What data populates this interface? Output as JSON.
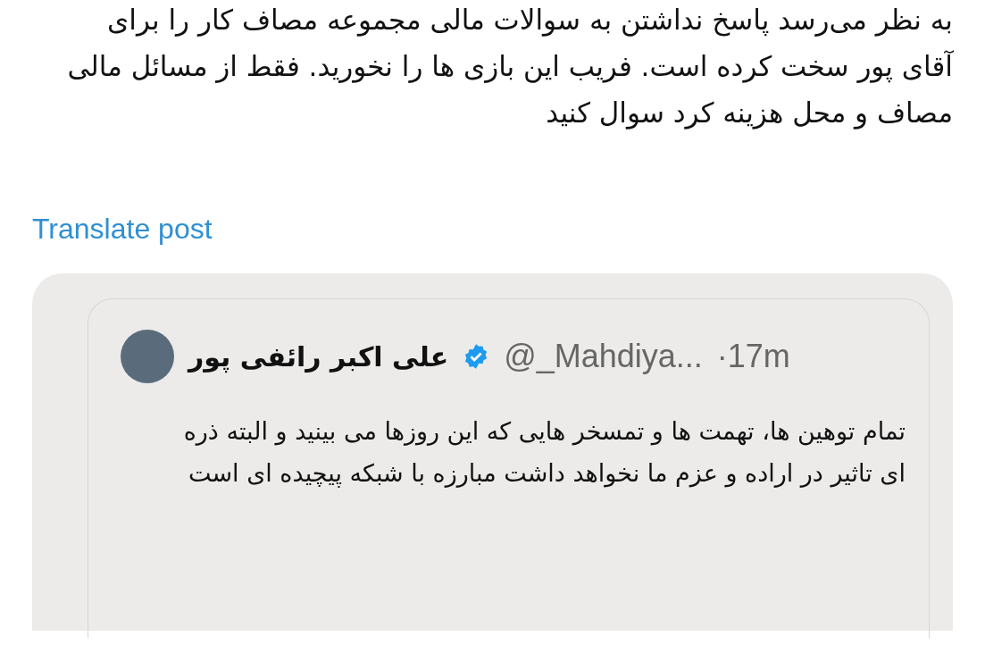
{
  "post": {
    "text": "به نظر می‌رسد پاسخ نداشتن به سوالات مالی مجموعه مصاف کار را برای آقای پور سخت کرده است. فریب این بازی ها را نخورید. فقط از مسائل مالی مصاف و محل هزینه کرد سوال کنید",
    "translate_link": "Translate post"
  },
  "quoted_post": {
    "author_name": "علی اکبر رائفی پور",
    "verified": true,
    "handle": "@_Mahdiya...",
    "time": "·17m",
    "text": "تمام توهین ها، تهمت ها و تمسخر هایی که این روزها می بینید و البته ذره ای تاثیر در اراده و عزم ما نخواهد داشت مبارزه با شبکه پیچیده ای است"
  }
}
